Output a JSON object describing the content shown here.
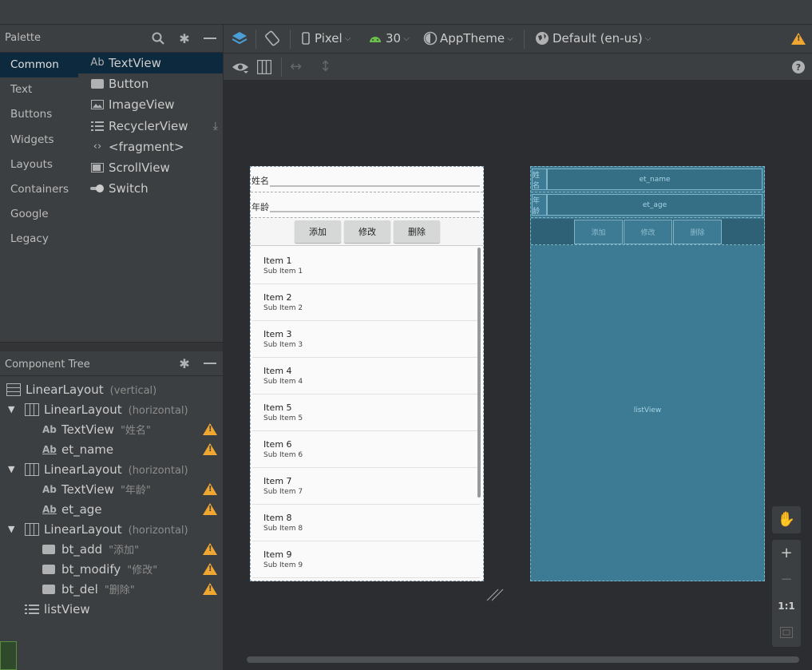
{
  "palette": {
    "title": "Palette",
    "categories": [
      "Common",
      "Text",
      "Buttons",
      "Widgets",
      "Layouts",
      "Containers",
      "Google",
      "Legacy"
    ],
    "selected_category": "Common",
    "items": [
      {
        "label": "TextView",
        "icon": "Ab"
      },
      {
        "label": "Button",
        "icon": "button-icon"
      },
      {
        "label": "ImageView",
        "icon": "image-icon"
      },
      {
        "label": "RecyclerView",
        "icon": "list-icon"
      },
      {
        "label": "<fragment>",
        "icon": "code-icon"
      },
      {
        "label": "ScrollView",
        "icon": "scroll-icon"
      },
      {
        "label": "Switch",
        "icon": "switch-icon"
      }
    ]
  },
  "component_tree": {
    "title": "Component Tree",
    "rows": [
      {
        "label": "LinearLayout",
        "sub": "(vertical)"
      },
      {
        "label": "LinearLayout",
        "sub": "(horizontal)"
      },
      {
        "label": "TextView",
        "sub": "\"姓名\""
      },
      {
        "label": "et_name",
        "sub": ""
      },
      {
        "label": "LinearLayout",
        "sub": "(horizontal)"
      },
      {
        "label": "TextView",
        "sub": "\"年龄\""
      },
      {
        "label": "et_age",
        "sub": ""
      },
      {
        "label": "LinearLayout",
        "sub": "(horizontal)"
      },
      {
        "label": "bt_add",
        "sub": "\"添加\""
      },
      {
        "label": "bt_modify",
        "sub": "\"修改\""
      },
      {
        "label": "bt_del",
        "sub": "\"删除\""
      },
      {
        "label": "listView",
        "sub": ""
      }
    ],
    "icon_text": "Ab"
  },
  "toolbar": {
    "device": "Pixel",
    "api": "30",
    "theme": "AppTheme",
    "locale": "Default (en-us)"
  },
  "design_preview": {
    "name_label": "姓名",
    "age_label": "年龄",
    "buttons": [
      "添加",
      "修改",
      "删除"
    ],
    "list_items": [
      {
        "title": "Item 1",
        "sub": "Sub Item 1"
      },
      {
        "title": "Item 2",
        "sub": "Sub Item 2"
      },
      {
        "title": "Item 3",
        "sub": "Sub Item 3"
      },
      {
        "title": "Item 4",
        "sub": "Sub Item 4"
      },
      {
        "title": "Item 5",
        "sub": "Sub Item 5"
      },
      {
        "title": "Item 6",
        "sub": "Sub Item 6"
      },
      {
        "title": "Item 7",
        "sub": "Sub Item 7"
      },
      {
        "title": "Item 8",
        "sub": "Sub Item 8"
      },
      {
        "title": "Item 9",
        "sub": "Sub Item 9"
      }
    ]
  },
  "blueprint": {
    "name_label": "姓名",
    "age_label": "年龄",
    "et_name": "et_name",
    "et_age": "et_age",
    "buttons": [
      "添加",
      "修改",
      "删除"
    ],
    "list_label": "listView"
  },
  "zoom": {
    "fit_label": "1:1"
  },
  "colors": {
    "selection": "#0d293e",
    "warning": "#f0a732",
    "blueprint": "#3d7b94"
  }
}
